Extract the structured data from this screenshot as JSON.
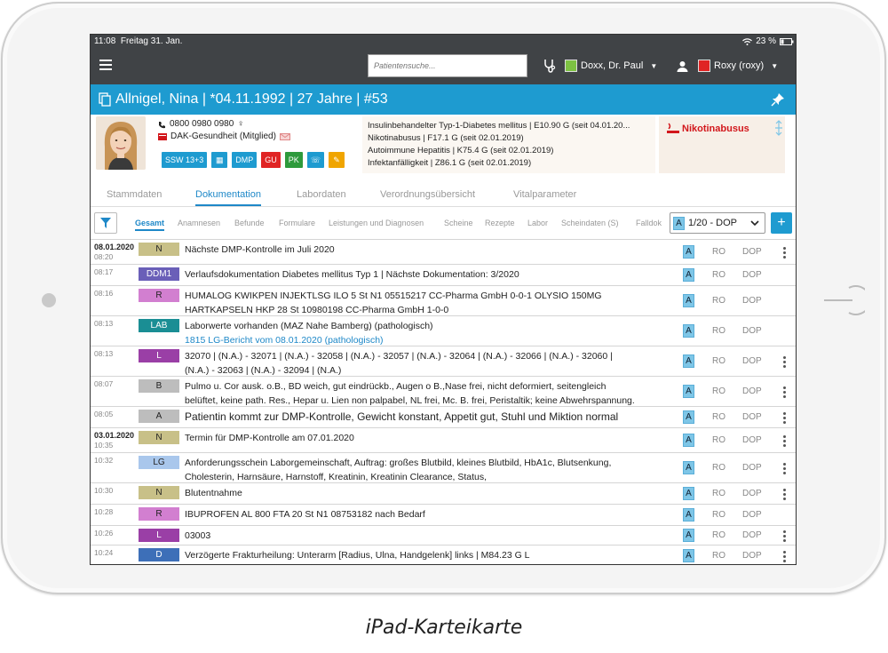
{
  "status": {
    "time": "11:08",
    "date": "Freitag 31. Jan.",
    "battery": "23 %"
  },
  "topbar": {
    "search_placeholder": "Patientensuche...",
    "doctor": {
      "name": "Doxx, Dr. Paul",
      "color": "#7dc242"
    },
    "user": {
      "name": "Roxy (roxy)",
      "color": "#e02424"
    }
  },
  "patient": {
    "header": "Allnigel, Nina | *04.11.1992 | 27 Jahre | #53",
    "phone": "0800 0980 0980",
    "gender_symbol": "♀",
    "insurance": "DAK-Gesundheit (Mitglied)",
    "chips": [
      {
        "label": "SSW 13+3",
        "color": "#1e9bd0"
      },
      {
        "label": "",
        "color": "#1e9bd0",
        "icon": "calendar-icon"
      },
      {
        "label": "DMP",
        "color": "#1e9bd0"
      },
      {
        "label": "GU",
        "color": "#e02424"
      },
      {
        "label": "PK",
        "color": "#2e9a3c"
      },
      {
        "label": "",
        "color": "#1e9bd0",
        "icon": "phone-icon"
      },
      {
        "label": "",
        "color": "#f0a500",
        "icon": "pencil-icon"
      }
    ],
    "diagnoses": [
      "Insulinbehandelter Typ-1-Diabetes mellitus | E10.90 G (seit 04.01.20...",
      "Nikotinabusus | F17.1 G (seit 02.01.2019)",
      "Autoimmune Hepatitis | K75.4 G (seit 02.01.2019)",
      "Infektanfälligkeit | Z86.1 G (seit 02.01.2019)"
    ],
    "alert": "Nikotinabusus"
  },
  "tabs": [
    "Stammdaten",
    "Dokumentation",
    "Labordaten",
    "Verordnungsübersicht",
    "Vitalparameter"
  ],
  "active_tab": "Dokumentation",
  "filters": [
    "Gesamt",
    "Anamnesen",
    "Befunde",
    "Formulare",
    "Leistungen und Diagnosen",
    "Scheine",
    "Rezepte",
    "Labor",
    "Scheindaten (S)",
    "Falldok"
  ],
  "dop_select": {
    "badge": "A",
    "value": "1/20 - DOP"
  },
  "entries": [
    {
      "date": "08.01.2020",
      "time": "08:20",
      "tag": "N",
      "tag_bg": "#c8c088",
      "tag_fg": "#222",
      "lines": [
        "Nächste DMP-Kontrolle im Juli 2020"
      ],
      "ro": "RO",
      "dop": "DOP",
      "more": true,
      "h": 28
    },
    {
      "date": "",
      "time": "08:17",
      "tag": "DDM1",
      "tag_bg": "#6a5fb8",
      "tag_fg": "#fff",
      "lines": [
        "Verlaufsdokumentation Diabetes mellitus Typ 1 | Nächste Dokumentation: 3/2020"
      ],
      "ro": "RO",
      "dop": "DOP",
      "more": false,
      "h": 24
    },
    {
      "date": "",
      "time": "08:16",
      "tag": "R",
      "tag_bg": "#d27fd0",
      "tag_fg": "#222",
      "lines": [
        "HUMALOG KWIKPEN INJEKTLSG ILO 5 St N1 05515217 CC-Pharma GmbH 0-0-1 OLYSIO 150MG",
        "HARTKAPSELN HKP 28 St 10980198 CC-Pharma GmbH 1-0-0"
      ],
      "ro": "RO",
      "dop": "DOP",
      "more": false,
      "h": 34
    },
    {
      "date": "",
      "time": "08:13",
      "tag": "LAB",
      "tag_bg": "#1a8e94",
      "tag_fg": "#fff",
      "lines": [
        "Laborwerte vorhanden (MAZ Nahe Bamberg) (pathologisch)"
      ],
      "link": "1815 LG-Bericht vom 08.01.2020 (pathologisch)",
      "ro": "RO",
      "dop": "DOP",
      "more": false,
      "h": 34
    },
    {
      "date": "",
      "time": "08:13",
      "tag": "L",
      "tag_bg": "#9a3fa6",
      "tag_fg": "#fff",
      "lines": [
        "32070 | (N.A.) - 32071 | (N.A.) - 32058 | (N.A.) - 32057 | (N.A.) - 32064 | (N.A.) - 32066 | (N.A.) - 32060 |",
        "(N.A.) - 32063 | (N.A.) - 32094 | (N.A.)"
      ],
      "ro": "RO",
      "dop": "DOP",
      "more": true,
      "h": 34
    },
    {
      "date": "",
      "time": "08:07",
      "tag": "B",
      "tag_bg": "#bdbdbd",
      "tag_fg": "#222",
      "lines": [
        "Pulmo u. Cor ausk. o.B., BD weich, gut eindrückb., Augen o B.,Nase frei, nicht deformiert, seitengleich",
        "belüftet, keine path. Res., Hepar u. Lien non palpabel, NL frei, Mc. B. frei, Peristaltik; keine Abwehrspannung."
      ],
      "ro": "RO",
      "dop": "DOP",
      "more": true,
      "h": 34
    },
    {
      "date": "",
      "time": "08:05",
      "tag": "A",
      "tag_bg": "#bdbdbd",
      "tag_fg": "#222",
      "lines": [
        "Patientin kommt zur DMP-Kontrolle, Gewicht konstant, Appetit gut, Stuhl und Miktion normal"
      ],
      "big": true,
      "ro": "RO",
      "dop": "DOP",
      "more": true,
      "h": 24
    },
    {
      "date": "03.01.2020",
      "time": "10:35",
      "tag": "N",
      "tag_bg": "#c8c088",
      "tag_fg": "#222",
      "lines": [
        "Termin für DMP-Kontrolle am 07.01.2020"
      ],
      "ro": "RO",
      "dop": "DOP",
      "more": true,
      "h": 28
    },
    {
      "date": "",
      "time": "10:32",
      "tag": "LG",
      "tag_bg": "#a9c7ec",
      "tag_fg": "#222",
      "lines": [
        "Anforderungsschein Laborgemeinschaft, Auftrag: großes Blutbild, kleines Blutbild, HbA1c, Blutsenkung,",
        "Cholesterin, Harnsäure, Harnstoff, Kreatinin, Kreatinin Clearance, Status,"
      ],
      "ro": "RO",
      "dop": "DOP",
      "more": true,
      "h": 34
    },
    {
      "date": "",
      "time": "10:30",
      "tag": "N",
      "tag_bg": "#c8c088",
      "tag_fg": "#222",
      "lines": [
        "Blutentnahme"
      ],
      "ro": "RO",
      "dop": "DOP",
      "more": true,
      "h": 24
    },
    {
      "date": "",
      "time": "10:28",
      "tag": "R",
      "tag_bg": "#d27fd0",
      "tag_fg": "#222",
      "lines": [
        "IBUPROFEN AL 800 FTA 20 St N1 08753182 nach Bedarf"
      ],
      "ro": "RO",
      "dop": "DOP",
      "more": false,
      "h": 24
    },
    {
      "date": "",
      "time": "10:26",
      "tag": "L",
      "tag_bg": "#9a3fa6",
      "tag_fg": "#fff",
      "lines": [
        "03003"
      ],
      "ro": "RO",
      "dop": "DOP",
      "more": true,
      "h": 22
    },
    {
      "date": "",
      "time": "10:24",
      "tag": "D",
      "tag_bg": "#3d6fb8",
      "tag_fg": "#fff",
      "lines": [
        "Verzögerte Frakturheilung: Unterarm [Radius, Ulna, Handgelenk] links | M84.23 G L"
      ],
      "ro": "RO",
      "dop": "DOP",
      "more": true,
      "h": 24
    }
  ],
  "entry_badge": "A",
  "caption": "iPad-Karteikarte"
}
